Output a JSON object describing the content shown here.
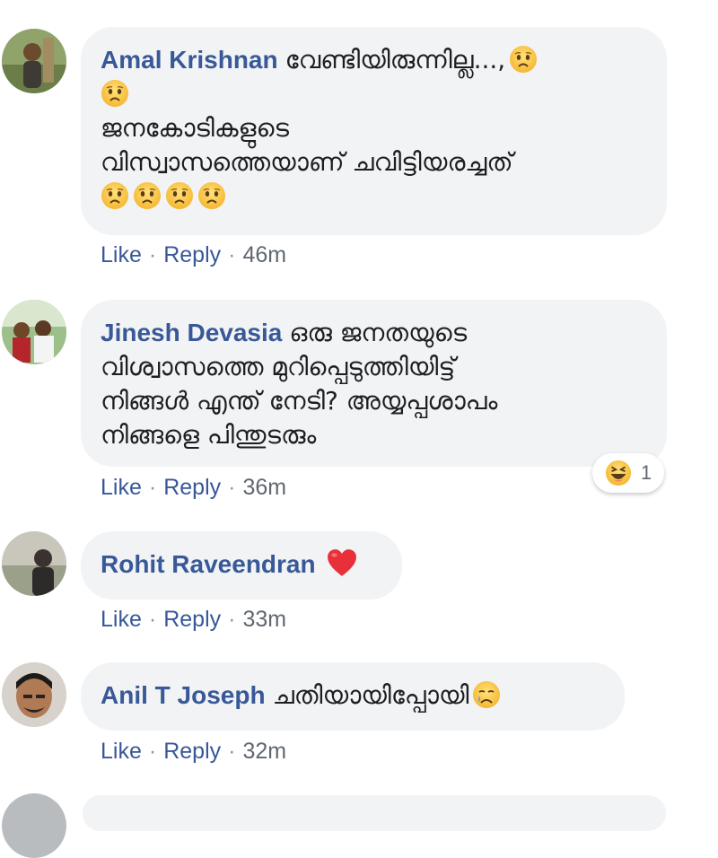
{
  "actions": {
    "like": "Like",
    "reply": "Reply",
    "separator": "·"
  },
  "comments": [
    {
      "author": "Amal Krishnan",
      "lines": [
        "വേണ്ടിയിരുന്നില്ല...,",
        "",
        "ജനകോടികളുടെ",
        "വിസ്വാസത്തെയാണ് ചവിട്ടിയരച്ചത്",
        ""
      ],
      "time": "46m"
    },
    {
      "author": "Jinesh Devasia",
      "lines": [
        "ഒരു ജനതയുടെ",
        "വിശ്വാസത്തെ മുറിപ്പെടുത്തിയിട്ട്",
        "നിങ്ങൾ എന്ത് നേടി? അയ്യപ്പശാപം",
        "നിങ്ങളെ പിന്തുടരും"
      ],
      "time": "36m",
      "reaction_count": "1"
    },
    {
      "author": "Rohit Raveendran",
      "lines": [
        ""
      ],
      "time": "33m"
    },
    {
      "author": "Anil T Joseph",
      "lines": [
        "ചതിയായിപ്പോയി"
      ],
      "time": "32m"
    }
  ],
  "icons": {
    "sad": "sad-face-emoji",
    "crying": "crying-face-emoji",
    "heart": "red-heart-emoji",
    "haha": "haha-reaction-icon"
  },
  "colors": {
    "name": "#385898",
    "bubble": "#f2f3f5",
    "meta": "#606770"
  }
}
